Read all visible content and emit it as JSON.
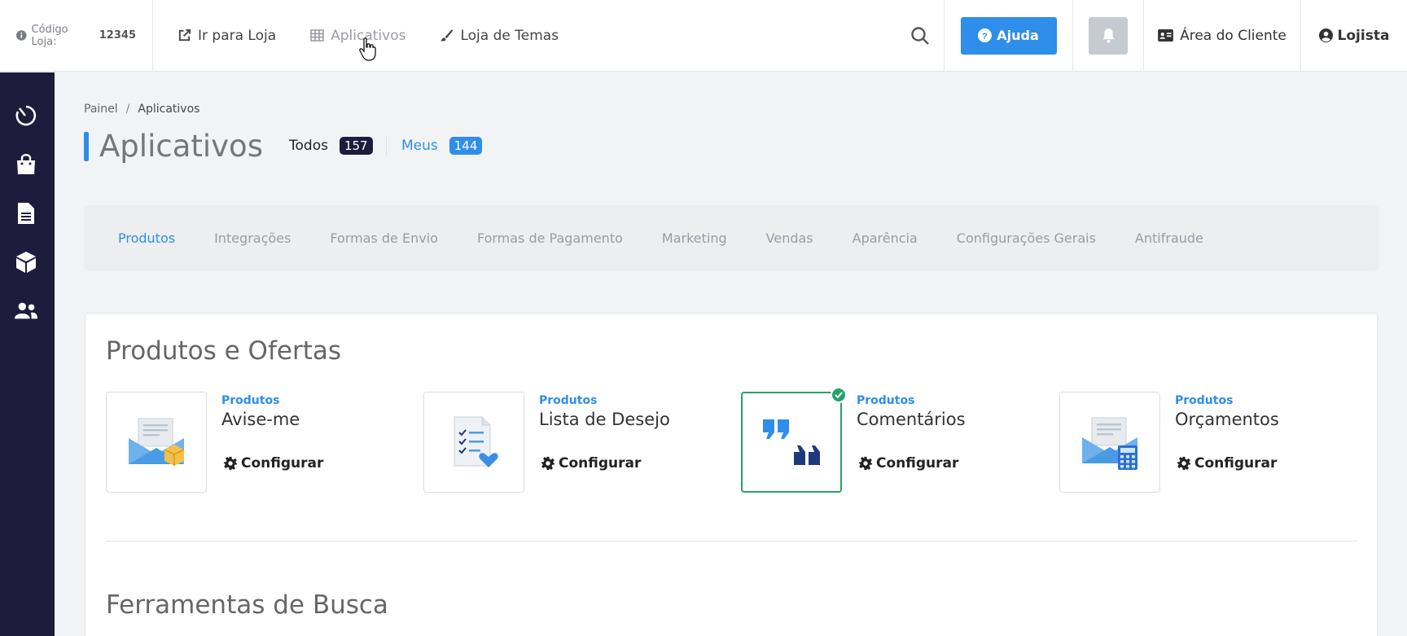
{
  "topbar": {
    "store_code_label": "Código Loja:",
    "store_code_value": "12345",
    "links": [
      {
        "label": "Ir para Loja",
        "icon": "external-link-icon",
        "muted": false
      },
      {
        "label": "Aplicativos",
        "icon": "grid-icon",
        "muted": true
      },
      {
        "label": "Loja de Temas",
        "icon": "brush-icon",
        "muted": false
      }
    ],
    "help_label": "Ajuda",
    "client_area_label": "Área do Cliente",
    "user_label": "Lojista"
  },
  "sidebar": {
    "items": [
      "dashboard-icon",
      "shopping-bag-icon",
      "document-icon",
      "box-icon",
      "users-icon"
    ]
  },
  "breadcrumb": {
    "root": "Painel",
    "separator": "/",
    "current": "Aplicativos"
  },
  "page": {
    "title": "Aplicativos",
    "filters": [
      {
        "label": "Todos",
        "count": "157",
        "active": true
      },
      {
        "label": "Meus",
        "count": "144",
        "active": false
      }
    ]
  },
  "tabs": [
    "Produtos",
    "Integrações",
    "Formas de Envio",
    "Formas de Pagamento",
    "Marketing",
    "Vendas",
    "Aparência",
    "Configurações Gerais",
    "Antifraude"
  ],
  "sections": [
    {
      "title": "Produtos e Ofertas"
    },
    {
      "title": "Ferramentas de Busca"
    }
  ],
  "apps": [
    {
      "category": "Produtos",
      "name": "Avise-me",
      "action": "Configurar",
      "installed": false,
      "icon": "envelope-box-icon"
    },
    {
      "category": "Produtos",
      "name": "Lista de Desejo",
      "action": "Configurar",
      "installed": false,
      "icon": "checklist-heart-icon"
    },
    {
      "category": "Produtos",
      "name": "Comentários",
      "action": "Configurar",
      "installed": true,
      "icon": "quotes-icon"
    },
    {
      "category": "Produtos",
      "name": "Orçamentos",
      "action": "Configurar",
      "installed": false,
      "icon": "envelope-calculator-icon"
    }
  ],
  "colors": {
    "accent": "#2e8ee9",
    "sidebar": "#1e1c3d",
    "installed": "#27a36a"
  }
}
